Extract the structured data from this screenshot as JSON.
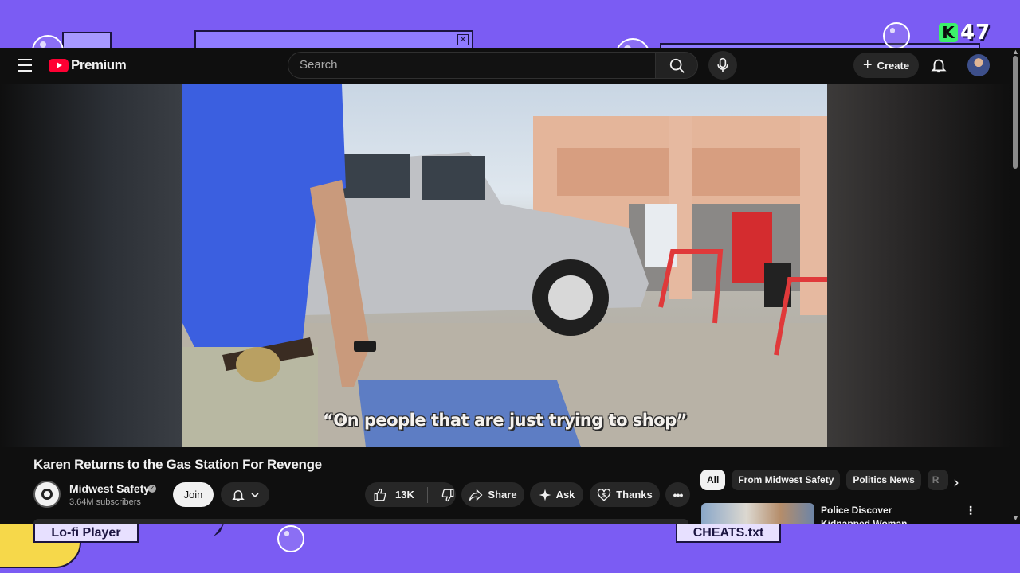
{
  "desktop": {
    "logo_badge_letter": "K",
    "logo_badge_number": "47",
    "taskbar_left_label": "Lo-fi Player",
    "taskbar_right_label": "CHEATS.txt",
    "accent_color": "#7b5cf3"
  },
  "youtube": {
    "logo_text": "Premium",
    "search_placeholder": "Search",
    "create_label": "Create",
    "video": {
      "caption": "“On people that are just trying to shop”",
      "title": "Karen Returns to the Gas Station For Revenge"
    },
    "channel": {
      "name": "Midwest Safety",
      "subscribers": "3.64M subscribers",
      "join_label": "Join"
    },
    "actions": {
      "likes": "13K",
      "share": "Share",
      "ask": "Ask",
      "thanks": "Thanks"
    },
    "chips": [
      "All",
      "From Midwest Safety",
      "Politics News",
      "R"
    ],
    "recommended": {
      "title": "Police Discover Kidnapped Woman Chained to Floor"
    },
    "icons": [
      "menu-icon",
      "search-icon",
      "mic-icon",
      "plus-icon",
      "bell-icon",
      "like-icon",
      "dislike-icon",
      "share-icon",
      "sparkle-icon",
      "thanks-icon",
      "more-icon",
      "chevron-right-icon"
    ]
  }
}
